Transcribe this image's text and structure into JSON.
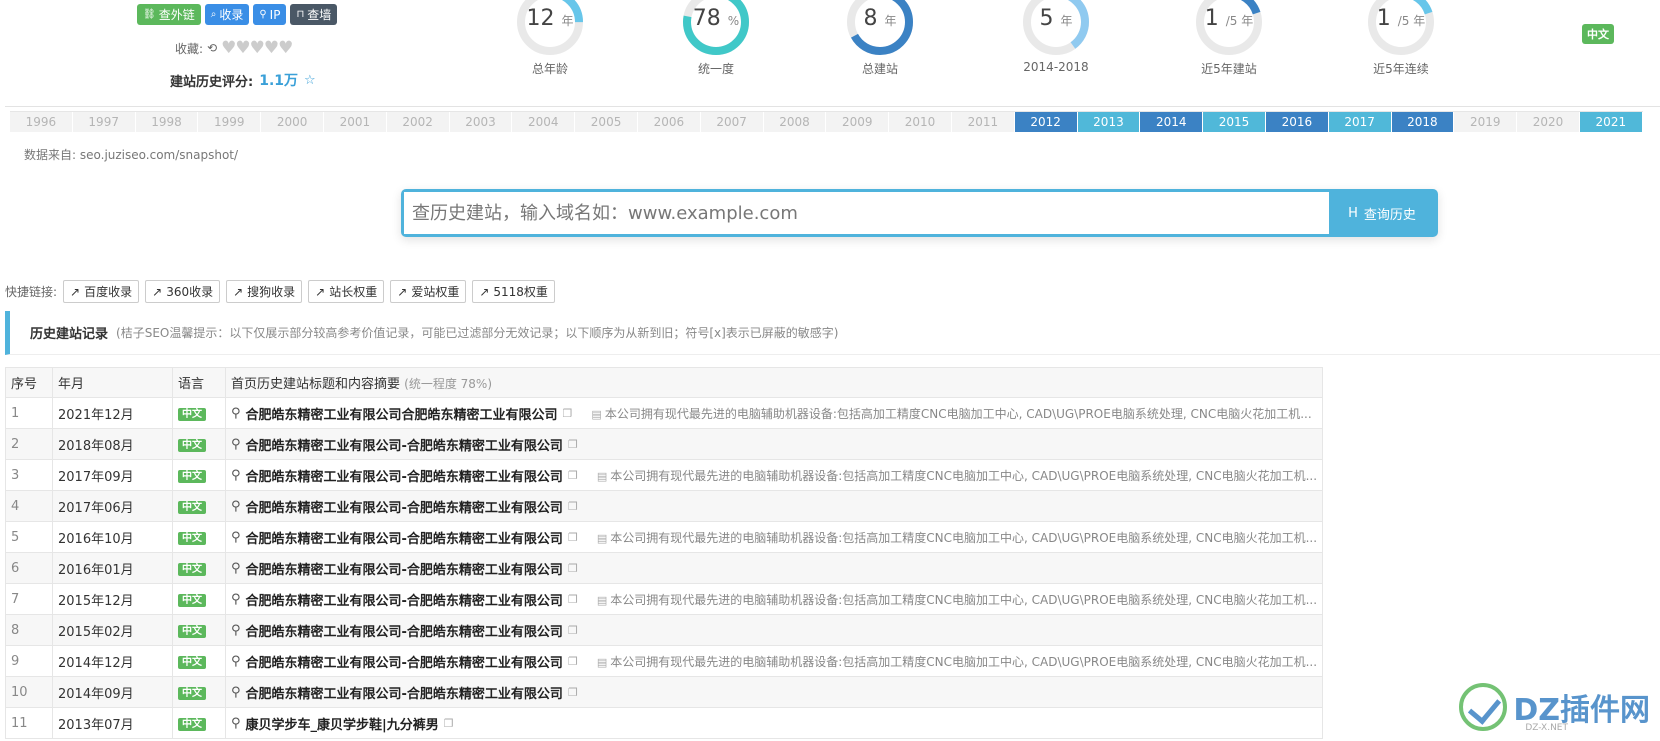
{
  "tags": [
    {
      "icon": "link-icon",
      "label": "查外链",
      "color": "#5cb85c"
    },
    {
      "icon": "search-icon",
      "label": "收录",
      "color": "#3a8ee6"
    },
    {
      "icon": "pin-icon",
      "label": "IP",
      "color": "#3a8ee6"
    },
    {
      "icon": "lock-icon",
      "label": "查墙",
      "color": "#4a5866"
    }
  ],
  "favorites": {
    "label": "收藏:",
    "count": 0
  },
  "history_score": {
    "label": "建站历史评分:",
    "value": "1.1万"
  },
  "gauges": [
    {
      "value": "12",
      "unit": "年",
      "label": "总年龄",
      "fraction": 0.25,
      "color": "#67c6ea"
    },
    {
      "value": "78",
      "unit": "%",
      "label": "统一度",
      "fraction": 0.78,
      "color": "#40c8c8"
    },
    {
      "value": "8",
      "unit": "年",
      "label": "总建站",
      "fraction": 0.67,
      "color": "#3b82c4"
    },
    {
      "value": "5",
      "unit": "年",
      "label": "2014-2018",
      "fraction": 0.4,
      "color": "#90caf0"
    },
    {
      "value": "1",
      "unit": "/5 年",
      "label": "近5年建站",
      "fraction": 0.2,
      "color": "#3b82c4"
    },
    {
      "value": "1",
      "unit": "/5 年",
      "label": "近5年连续",
      "fraction": 0.2,
      "color": "#67c6ea"
    }
  ],
  "lang_badge": "中文",
  "years": [
    {
      "y": "1996",
      "s": "off"
    },
    {
      "y": "1997",
      "s": "off"
    },
    {
      "y": "1998",
      "s": "off"
    },
    {
      "y": "1999",
      "s": "off"
    },
    {
      "y": "2000",
      "s": "off"
    },
    {
      "y": "2001",
      "s": "off"
    },
    {
      "y": "2002",
      "s": "off"
    },
    {
      "y": "2003",
      "s": "off"
    },
    {
      "y": "2004",
      "s": "off"
    },
    {
      "y": "2005",
      "s": "off"
    },
    {
      "y": "2006",
      "s": "off"
    },
    {
      "y": "2007",
      "s": "off"
    },
    {
      "y": "2008",
      "s": "off"
    },
    {
      "y": "2009",
      "s": "off"
    },
    {
      "y": "2010",
      "s": "off"
    },
    {
      "y": "2011",
      "s": "off"
    },
    {
      "y": "2012",
      "s": "dark"
    },
    {
      "y": "2013",
      "s": "light"
    },
    {
      "y": "2014",
      "s": "dark"
    },
    {
      "y": "2015",
      "s": "light"
    },
    {
      "y": "2016",
      "s": "dark"
    },
    {
      "y": "2017",
      "s": "light"
    },
    {
      "y": "2018",
      "s": "dark"
    },
    {
      "y": "2019",
      "s": "off"
    },
    {
      "y": "2020",
      "s": "off"
    },
    {
      "y": "2021",
      "s": "light"
    }
  ],
  "source": "数据来自: seo.juziseo.com/snapshot/",
  "search": {
    "placeholder": "查历史建站，输入域名如：www.example.com",
    "button": "查询历史"
  },
  "quick_links": {
    "label": "快捷链接:",
    "items": [
      "百度收录",
      "360收录",
      "搜狗收录",
      "站长权重",
      "爱站权重",
      "5118权重"
    ]
  },
  "section": {
    "title": "历史建站记录",
    "tip": "(桔子SEO温馨提示：以下仅展示部分较高参考价值记录，可能已过滤部分无效记录；以下顺序为从新到旧；符号[x]表示已屏蔽的敏感字)"
  },
  "table": {
    "headers": {
      "idx": "序号",
      "date": "年月",
      "lang": "语言",
      "title": "首页历史建站标题和内容摘要",
      "title_note": "(统一程度 78%)"
    },
    "rows": [
      {
        "idx": "1",
        "date": "2021年12月",
        "lang": "中文",
        "title": "合肥皓东精密工业有限公司合肥皓东精密工业有限公司",
        "summary": "本公司拥有现代最先进的电脑辅助机器设备:包括高加工精度CNC电脑加工中心, CAD\\UG\\PROE电脑系统处理, CNC电脑火花加工机..."
      },
      {
        "idx": "2",
        "date": "2018年08月",
        "lang": "中文",
        "title": "合肥皓东精密工业有限公司-合肥皓东精密工业有限公司",
        "summary": ""
      },
      {
        "idx": "3",
        "date": "2017年09月",
        "lang": "中文",
        "title": "合肥皓东精密工业有限公司-合肥皓东精密工业有限公司",
        "summary": "本公司拥有现代最先进的电脑辅助机器设备:包括高加工精度CNC电脑加工中心, CAD\\UG\\PROE电脑系统处理, CNC电脑火花加工机..."
      },
      {
        "idx": "4",
        "date": "2017年06月",
        "lang": "中文",
        "title": "合肥皓东精密工业有限公司-合肥皓东精密工业有限公司",
        "summary": ""
      },
      {
        "idx": "5",
        "date": "2016年10月",
        "lang": "中文",
        "title": "合肥皓东精密工业有限公司-合肥皓东精密工业有限公司",
        "summary": "本公司拥有现代最先进的电脑辅助机器设备:包括高加工精度CNC电脑加工中心, CAD\\UG\\PROE电脑系统处理, CNC电脑火花加工机..."
      },
      {
        "idx": "6",
        "date": "2016年01月",
        "lang": "中文",
        "title": "合肥皓东精密工业有限公司-合肥皓东精密工业有限公司",
        "summary": ""
      },
      {
        "idx": "7",
        "date": "2015年12月",
        "lang": "中文",
        "title": "合肥皓东精密工业有限公司-合肥皓东精密工业有限公司",
        "summary": "本公司拥有现代最先进的电脑辅助机器设备:包括高加工精度CNC电脑加工中心, CAD\\UG\\PROE电脑系统处理, CNC电脑火花加工机..."
      },
      {
        "idx": "8",
        "date": "2015年02月",
        "lang": "中文",
        "title": "合肥皓东精密工业有限公司-合肥皓东精密工业有限公司",
        "summary": ""
      },
      {
        "idx": "9",
        "date": "2014年12月",
        "lang": "中文",
        "title": "合肥皓东精密工业有限公司-合肥皓东精密工业有限公司",
        "summary": "本公司拥有现代最先进的电脑辅助机器设备:包括高加工精度CNC电脑加工中心, CAD\\UG\\PROE电脑系统处理, CNC电脑火花加工机..."
      },
      {
        "idx": "10",
        "date": "2014年09月",
        "lang": "中文",
        "title": "合肥皓东精密工业有限公司-合肥皓东精密工业有限公司",
        "summary": ""
      },
      {
        "idx": "11",
        "date": "2013年07月",
        "lang": "中文",
        "title": "康贝学步车_康贝学步鞋|九分裤男",
        "summary": ""
      }
    ]
  },
  "watermark": {
    "text": "DZ插件网",
    "sub": "DZ-X.NET"
  }
}
